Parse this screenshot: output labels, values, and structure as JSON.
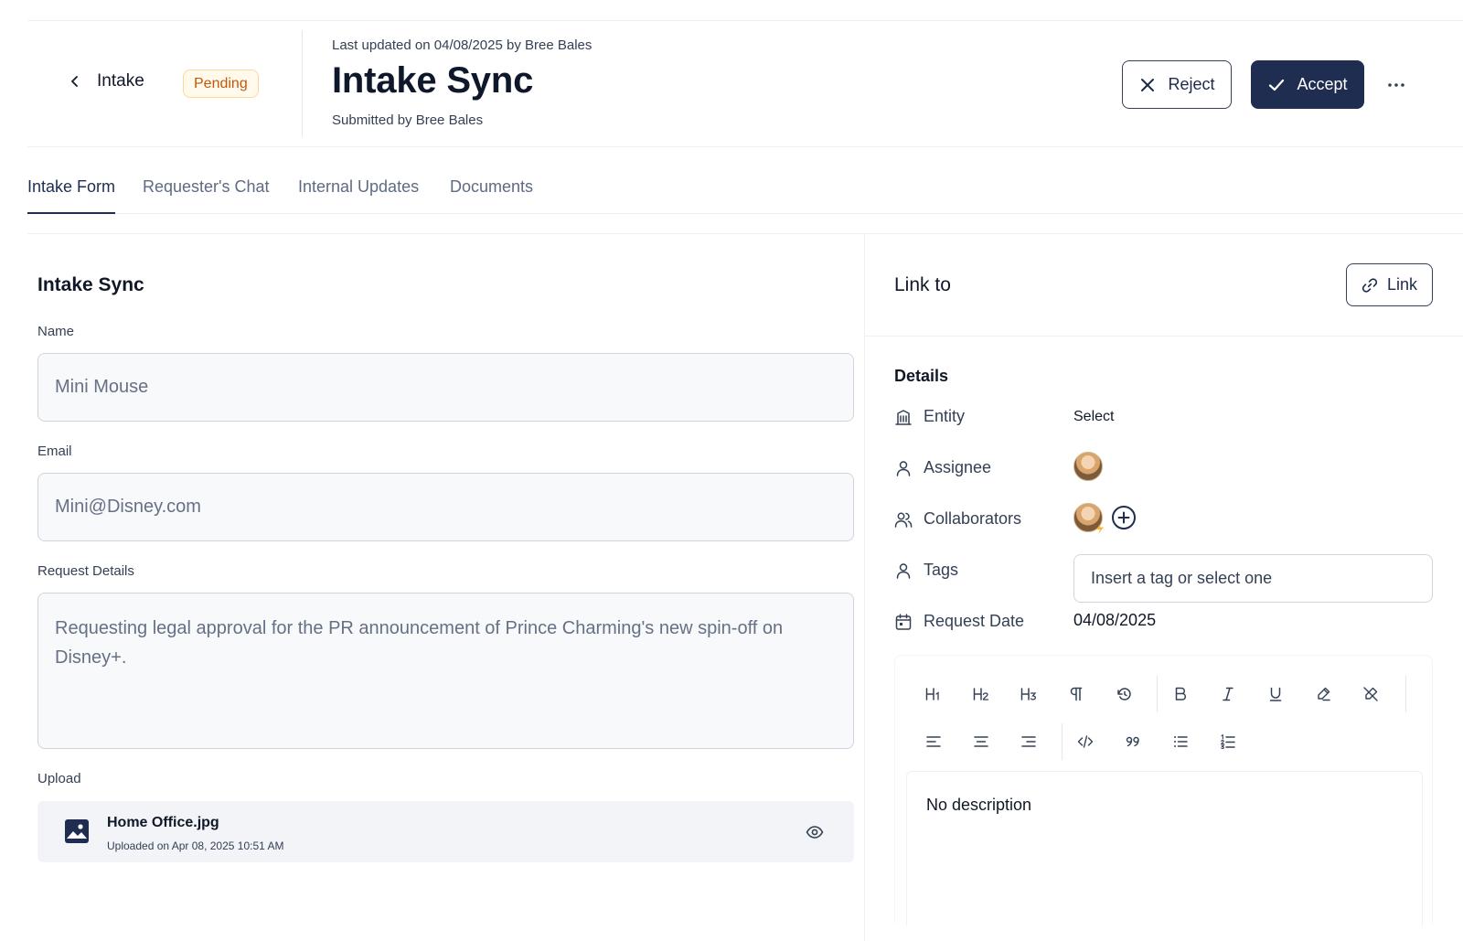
{
  "header": {
    "back_label": "Intake",
    "status_badge": "Pending",
    "last_updated": "Last updated on 04/08/2025 by Bree Bales",
    "title": "Intake Sync",
    "submitted_by": "Submitted by Bree Bales",
    "reject_label": "Reject",
    "accept_label": "Accept",
    "more_icon": "more-horizontal-icon"
  },
  "tabs": [
    {
      "label": "Intake Form",
      "active": true
    },
    {
      "label": "Requester's Chat",
      "active": false
    },
    {
      "label": "Internal Updates",
      "active": false
    },
    {
      "label": "Documents",
      "active": false
    }
  ],
  "form": {
    "title": "Intake Sync",
    "name_label": "Name",
    "name_value": "Mini Mouse",
    "email_label": "Email",
    "email_value": "Mini@Disney.com",
    "details_label": "Request Details",
    "details_value": "Requesting legal approval for the PR announcement of Prince Charming's new spin-off on Disney+.",
    "upload_label": "Upload",
    "upload": {
      "file_name": "Home Office.jpg",
      "uploaded_on": "Uploaded on Apr 08, 2025 10:51 AM"
    }
  },
  "link_panel": {
    "title": "Link to",
    "button_label": "Link"
  },
  "details": {
    "title": "Details",
    "entity_label": "Entity",
    "entity_value": "Select",
    "assignee_label": "Assignee",
    "collaborators_label": "Collaborators",
    "tags_label": "Tags",
    "tags_placeholder": "Insert a tag or select one",
    "request_date_label": "Request Date",
    "request_date_value": "04/08/2025"
  },
  "editor": {
    "toolbar_row1": [
      "H1",
      "H2",
      "H3",
      "paragraph",
      "undo",
      "bold",
      "italic",
      "underline",
      "highlight",
      "clear-format"
    ],
    "toolbar_row2": [
      "align-left",
      "align-center",
      "align-right",
      "code",
      "quote",
      "bullet-list",
      "ordered-list"
    ],
    "content": "No description"
  },
  "colors": {
    "primary": "#1e2d50",
    "badge_bg": "#fffaeb",
    "badge_text": "#c4570b",
    "input_bg": "#f8f9fb"
  }
}
